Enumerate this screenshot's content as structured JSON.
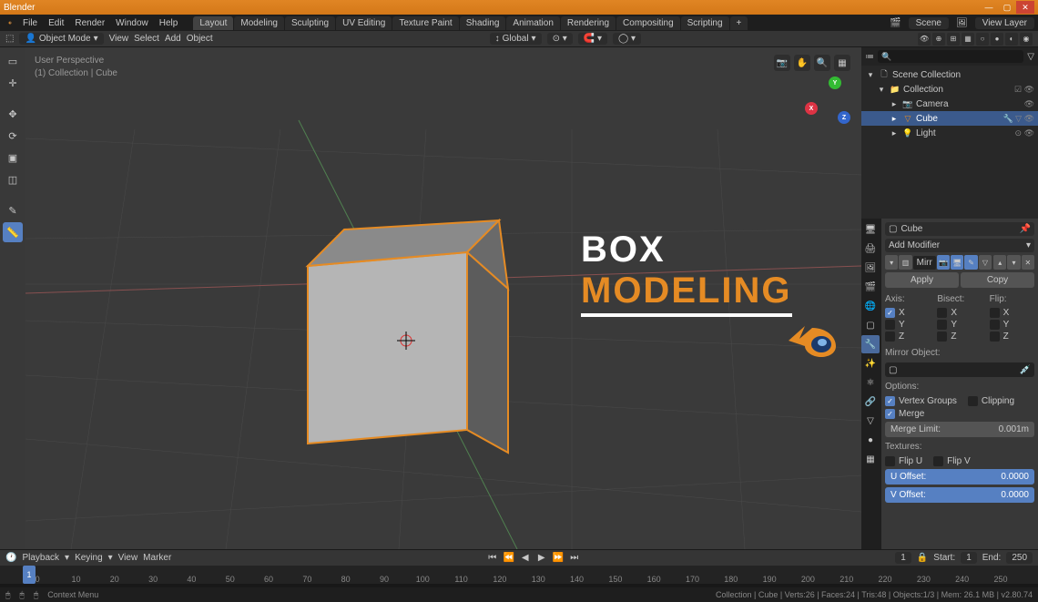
{
  "app": {
    "title": "Blender"
  },
  "menu": {
    "file": "File",
    "edit": "Edit",
    "render": "Render",
    "window": "Window",
    "help": "Help"
  },
  "workspaces": [
    "Layout",
    "Modeling",
    "Sculpting",
    "UV Editing",
    "Texture Paint",
    "Shading",
    "Animation",
    "Rendering",
    "Compositing",
    "Scripting"
  ],
  "scene_pill": "Scene",
  "viewlayer_pill": "View Layer",
  "header": {
    "mode": "Object Mode",
    "view": "View",
    "select": "Select",
    "add": "Add",
    "object": "Object",
    "orientation": "Global"
  },
  "hud": {
    "line1": "User Perspective",
    "line2": "(1) Collection | Cube"
  },
  "overlay": {
    "l1": "BOX",
    "l2": "MODELING"
  },
  "outliner": {
    "scene_collection": "Scene Collection",
    "collection": "Collection",
    "camera": "Camera",
    "cube": "Cube",
    "light": "Light"
  },
  "props": {
    "obj_name": "Cube",
    "add_modifier": "Add Modifier",
    "mod_name": "Mirr",
    "apply": "Apply",
    "copy": "Copy",
    "axis": "Axis:",
    "bisect": "Bisect:",
    "flip": "Flip:",
    "x": "X",
    "y": "Y",
    "z": "Z",
    "mirror_object": "Mirror Object:",
    "options": "Options:",
    "vertex_groups": "Vertex Groups",
    "clipping": "Clipping",
    "merge": "Merge",
    "merge_limit": "Merge Limit:",
    "merge_val": "0.001m",
    "textures": "Textures:",
    "flip_u": "Flip U",
    "flip_v": "Flip V",
    "u_offset": "U Offset:",
    "v_offset": "V Offset:",
    "uv_val": "0.0000"
  },
  "timeline": {
    "playback": "Playback",
    "keying": "Keying",
    "view": "View",
    "marker": "Marker",
    "cur": "1",
    "start_l": "Start:",
    "start": "1",
    "end_l": "End:",
    "end": "250",
    "ticks": [
      "0",
      "10",
      "20",
      "30",
      "40",
      "50",
      "60",
      "70",
      "80",
      "90",
      "100",
      "110",
      "120",
      "130",
      "140",
      "150",
      "160",
      "170",
      "180",
      "190",
      "200",
      "210",
      "220",
      "230",
      "240",
      "250"
    ]
  },
  "status": {
    "context": "Context Menu",
    "info": "Collection | Cube | Verts:26 | Faces:24 | Tris:48 | Objects:1/3 | Mem: 26.1 MB | v2.80.74"
  }
}
